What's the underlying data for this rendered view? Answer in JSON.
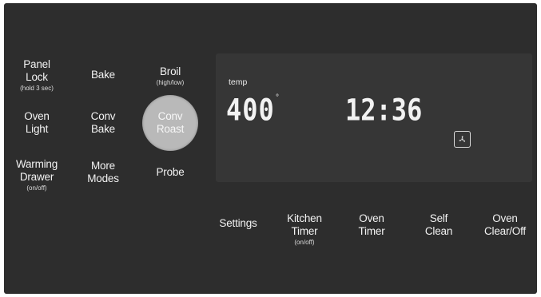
{
  "left_buttons": [
    {
      "label": "Panel\nLock",
      "sub": "(hold 3 sec)"
    },
    {
      "label": "Bake",
      "sub": ""
    },
    {
      "label": "Broil",
      "sub": "(high/low)"
    },
    {
      "label": "Oven\nLight",
      "sub": ""
    },
    {
      "label": "Conv\nBake",
      "sub": ""
    },
    {
      "label": "Conv\nRoast",
      "sub": "",
      "selected": true
    },
    {
      "label": "Warming\nDrawer",
      "sub": "(on/off)"
    },
    {
      "label": "More\nModes",
      "sub": ""
    },
    {
      "label": "Probe",
      "sub": ""
    }
  ],
  "display": {
    "temp_label": "temp",
    "temperature": "400",
    "degree_symbol": "°",
    "clock": "12:36",
    "convection_fan_icon": "convection-fan-icon"
  },
  "bottom_buttons": [
    {
      "label": "Settings",
      "sub": ""
    },
    {
      "label": "Kitchen\nTimer",
      "sub": "(on/off)"
    },
    {
      "label": "Oven\nTimer",
      "sub": ""
    },
    {
      "label": "Self\nClean",
      "sub": ""
    },
    {
      "label": "Oven\nClear/Off",
      "sub": ""
    }
  ],
  "colors": {
    "panel_background": "#2d2d2d",
    "display_background": "#363636",
    "text": "#f2f2f2",
    "selected_circle": "#b9b9b9"
  }
}
